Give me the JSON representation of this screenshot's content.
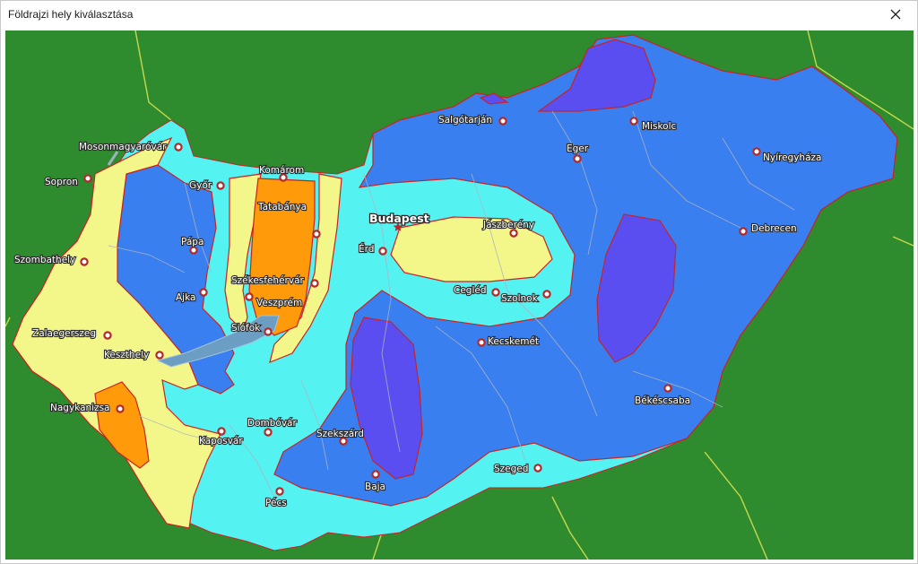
{
  "window": {
    "title": "Földrajzi hely kiválasztása",
    "close_icon": "close-icon"
  },
  "map": {
    "colors": {
      "background": "#2e8b2e",
      "zone_yellow": "#f3f78a",
      "zone_cyan": "#55f2f2",
      "zone_blue": "#3a7ff0",
      "zone_violet": "#5a4ef0",
      "zone_orange": "#ff9a0a",
      "zone_border": "#cc2222",
      "lake": "#6c9ec4",
      "city_marker": "#b22a2a"
    },
    "capital": "Budapest",
    "cities": [
      "Mosonmagyaróvár",
      "Sopron",
      "Győr",
      "Komárom",
      "Tatabánya",
      "Pápa",
      "Szombathely",
      "Székesfehérvár",
      "Ajka",
      "Veszprém",
      "Siófok",
      "Zalaegerszeg",
      "Keszthely",
      "Nagykanizsa",
      "Kaposvár",
      "Dombóvár",
      "Pécs",
      "Szekszárd",
      "Baja",
      "Érd",
      "Cegléd",
      "Szolnok",
      "Jászberény",
      "Kecskemét",
      "Salgótarján",
      "Eger",
      "Miskolc",
      "Nyíregyháza",
      "Debrecen",
      "Békéscsaba",
      "Szeged"
    ]
  }
}
